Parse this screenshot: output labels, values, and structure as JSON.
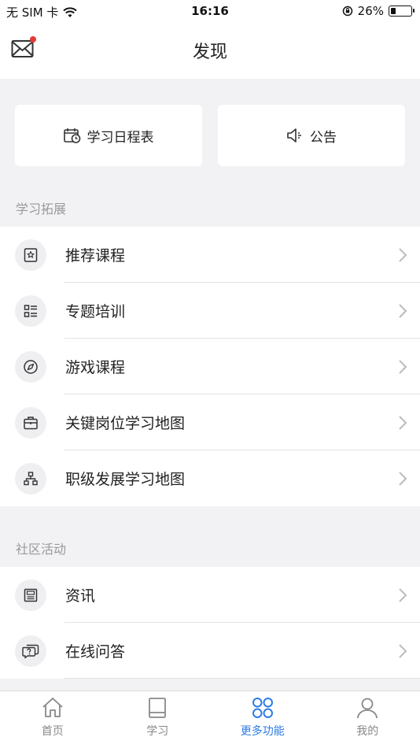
{
  "status_bar": {
    "carrier": "无 SIM 卡",
    "time": "16:16",
    "battery_percent_label": "26%",
    "battery_level": 0.26
  },
  "nav": {
    "title": "发现",
    "has_unread_badge": true
  },
  "quick_actions": [
    {
      "label": "学习日程表",
      "icon": "calendar-clock-icon"
    },
    {
      "label": "公告",
      "icon": "speaker-icon"
    }
  ],
  "sections": [
    {
      "header": "学习拓展",
      "items": [
        {
          "label": "推荐课程",
          "icon": "star-bookmark-icon"
        },
        {
          "label": "专题培训",
          "icon": "list-grid-icon"
        },
        {
          "label": "游戏课程",
          "icon": "compass-icon"
        },
        {
          "label": "关键岗位学习地图",
          "icon": "briefcase-icon"
        },
        {
          "label": "职级发展学习地图",
          "icon": "hierarchy-icon"
        }
      ]
    },
    {
      "header": "社区活动",
      "items": [
        {
          "label": "资讯",
          "icon": "newspaper-icon"
        },
        {
          "label": "在线问答",
          "icon": "chat-question-icon"
        }
      ]
    }
  ],
  "tabs": [
    {
      "label": "首页",
      "icon": "home-icon",
      "active": false
    },
    {
      "label": "学习",
      "icon": "book-icon",
      "active": false
    },
    {
      "label": "更多功能",
      "icon": "clover-grid-icon",
      "active": true
    },
    {
      "label": "我的",
      "icon": "person-icon",
      "active": false
    }
  ],
  "colors": {
    "accent": "#2c7be5",
    "badge": "#e53935",
    "background": "#f2f2f5"
  }
}
